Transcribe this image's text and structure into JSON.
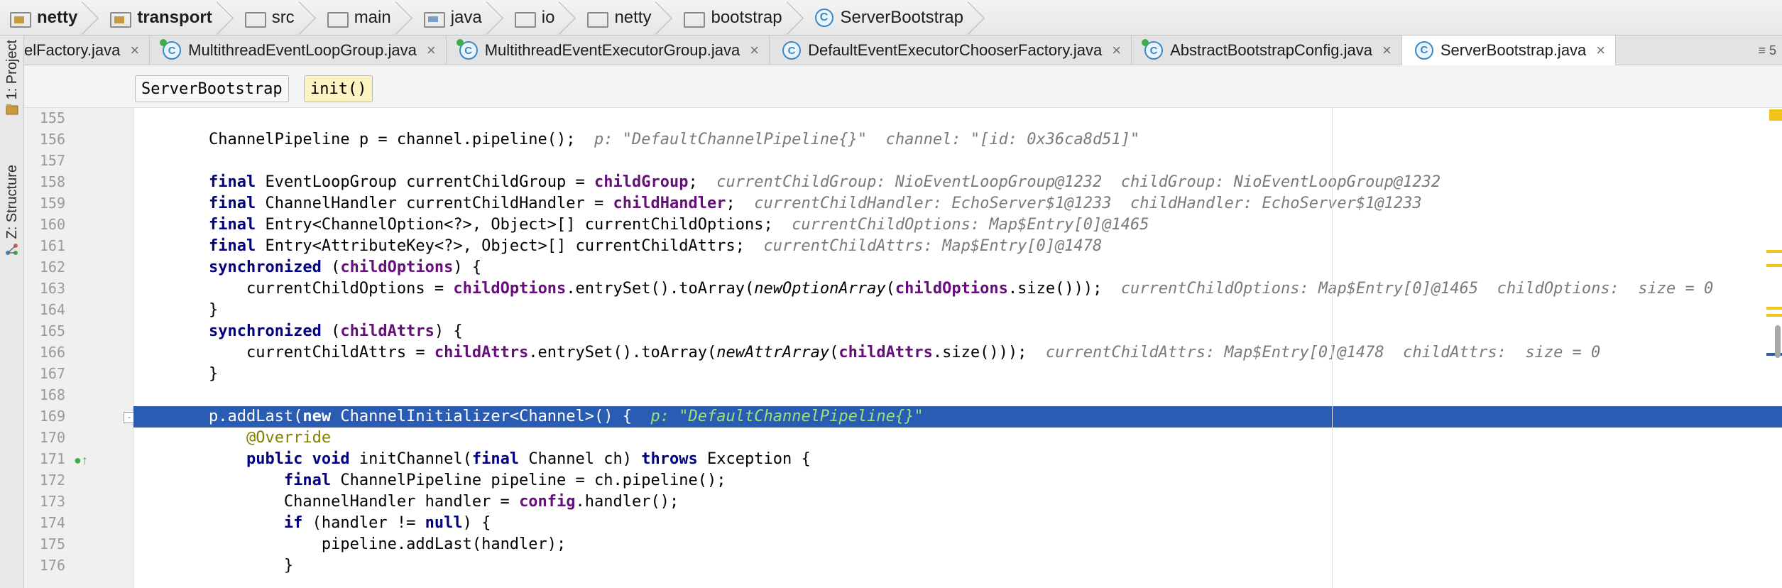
{
  "breadcrumbs": [
    {
      "label": "netty",
      "bold": true,
      "icon": "module-folder-icon"
    },
    {
      "label": "transport",
      "bold": true,
      "icon": "module-folder-icon"
    },
    {
      "label": "src",
      "bold": false,
      "icon": "folder-icon"
    },
    {
      "label": "main",
      "bold": false,
      "icon": "folder-icon"
    },
    {
      "label": "java",
      "bold": false,
      "icon": "source-folder-icon"
    },
    {
      "label": "io",
      "bold": false,
      "icon": "package-icon"
    },
    {
      "label": "netty",
      "bold": false,
      "icon": "package-icon"
    },
    {
      "label": "bootstrap",
      "bold": false,
      "icon": "package-icon"
    },
    {
      "label": "ServerBootstrap",
      "bold": false,
      "icon": "class-icon"
    }
  ],
  "tool_windows": {
    "project": "1: Project",
    "structure": "Z: Structure"
  },
  "tabs": [
    {
      "label": "elFactory.java",
      "icon": "class-icon"
    },
    {
      "label": "MultithreadEventLoopGroup.java",
      "icon": "abstract-class-icon"
    },
    {
      "label": "MultithreadEventExecutorGroup.java",
      "icon": "abstract-class-icon"
    },
    {
      "label": "DefaultEventExecutorChooserFactory.java",
      "icon": "class-icon"
    },
    {
      "label": "AbstractBootstrapConfig.java",
      "icon": "abstract-class-icon"
    },
    {
      "label": "ServerBootstrap.java",
      "icon": "class-icon",
      "active": true
    }
  ],
  "tab_overflow": "≡ 5",
  "close_glyph": "×",
  "class_glyph": "C",
  "method_breadcrumb": {
    "class_name": "ServerBootstrap",
    "method_name": "init()"
  },
  "line_numbers": [
    "155",
    "156",
    "157",
    "158",
    "159",
    "160",
    "161",
    "162",
    "163",
    "164",
    "165",
    "166",
    "167",
    "168",
    "169",
    "170",
    "171",
    "172",
    "173",
    "174",
    "175",
    "176"
  ],
  "code": {
    "l156": {
      "code": "        ChannelPipeline p = channel.pipeline();",
      "hint": "p: \"DefaultChannelPipeline{}\"  channel: \"[id: 0x36ca8d51]\""
    },
    "l158": {
      "kw": "final",
      "code": " EventLoopGroup currentChildGroup = ",
      "fld": "childGroup",
      "tail": ";",
      "hint": "currentChildGroup: NioEventLoopGroup@1232  childGroup: NioEventLoopGroup@1232"
    },
    "l159": {
      "kw": "final",
      "code": " ChannelHandler currentChildHandler = ",
      "fld": "childHandler",
      "tail": ";",
      "hint": "currentChildHandler: EchoServer$1@1233  childHandler: EchoServer$1@1233"
    },
    "l160": {
      "kw": "final",
      "code": " Entry<ChannelOption<?>, Object>[] currentChildOptions;",
      "hint": "currentChildOptions: Map$Entry[0]@1465"
    },
    "l161": {
      "kw": "final",
      "code": " Entry<AttributeKey<?>, Object>[] currentChildAttrs;",
      "hint": "currentChildAttrs: Map$Entry[0]@1478"
    },
    "l162": {
      "kw": "synchronized",
      "code": " (",
      "fld": "childOptions",
      "tail": ") {"
    },
    "l163": {
      "pre": "currentChildOptions = ",
      "fld": "childOptions",
      "mid": ".entrySet().toArray(",
      "it": "newOptionArray",
      "mid2": "(",
      "fld2": "childOptions",
      "tail": ".size()));",
      "hint": "currentChildOptions: Map$Entry[0]@1465  childOptions:  size = 0"
    },
    "l164": "}",
    "l165": {
      "kw": "synchronized",
      "code": " (",
      "fld": "childAttrs",
      "tail": ") {"
    },
    "l166": {
      "pre": "currentChildAttrs = ",
      "fld": "childAttrs",
      "mid": ".entrySet().toArray(",
      "it": "newAttrArray",
      "mid2": "(",
      "fld2": "childAttrs",
      "tail": ".size()));",
      "hint": "currentChildAttrs: Map$Entry[0]@1478  childAttrs:  size = 0"
    },
    "l167": "}",
    "l169": {
      "pre": "p.addLast(",
      "kw": "new",
      "tail": " ChannelInitializer<Channel>() {",
      "hint": "p: \"DefaultChannelPipeline{}\""
    },
    "l170": "@Override",
    "l171": {
      "kw": "public void",
      "code": " initChannel(",
      "kw2": "final",
      "code2": " Channel ch) ",
      "kw3": "throws",
      "tail": " Exception {"
    },
    "l172": {
      "kw": "final",
      "tail": " ChannelPipeline pipeline = ch.pipeline();"
    },
    "l173": {
      "pre": "ChannelHandler handler = ",
      "fld": "config",
      "tail": ".handler();"
    },
    "l174": {
      "kw": "if",
      "code": " (handler != ",
      "kw2": "null",
      "tail": ") {"
    },
    "l175": "pipeline.addLast(handler);",
    "l176": "}"
  },
  "fold_glyph": "-",
  "impl_glyph": "●↑",
  "colors": {
    "keyword": "#000080",
    "field": "#660e7a",
    "annotation": "#808000",
    "hint": "#7a7a7a",
    "selection": "#2a5cb3",
    "selection_hint": "#99e37a"
  }
}
